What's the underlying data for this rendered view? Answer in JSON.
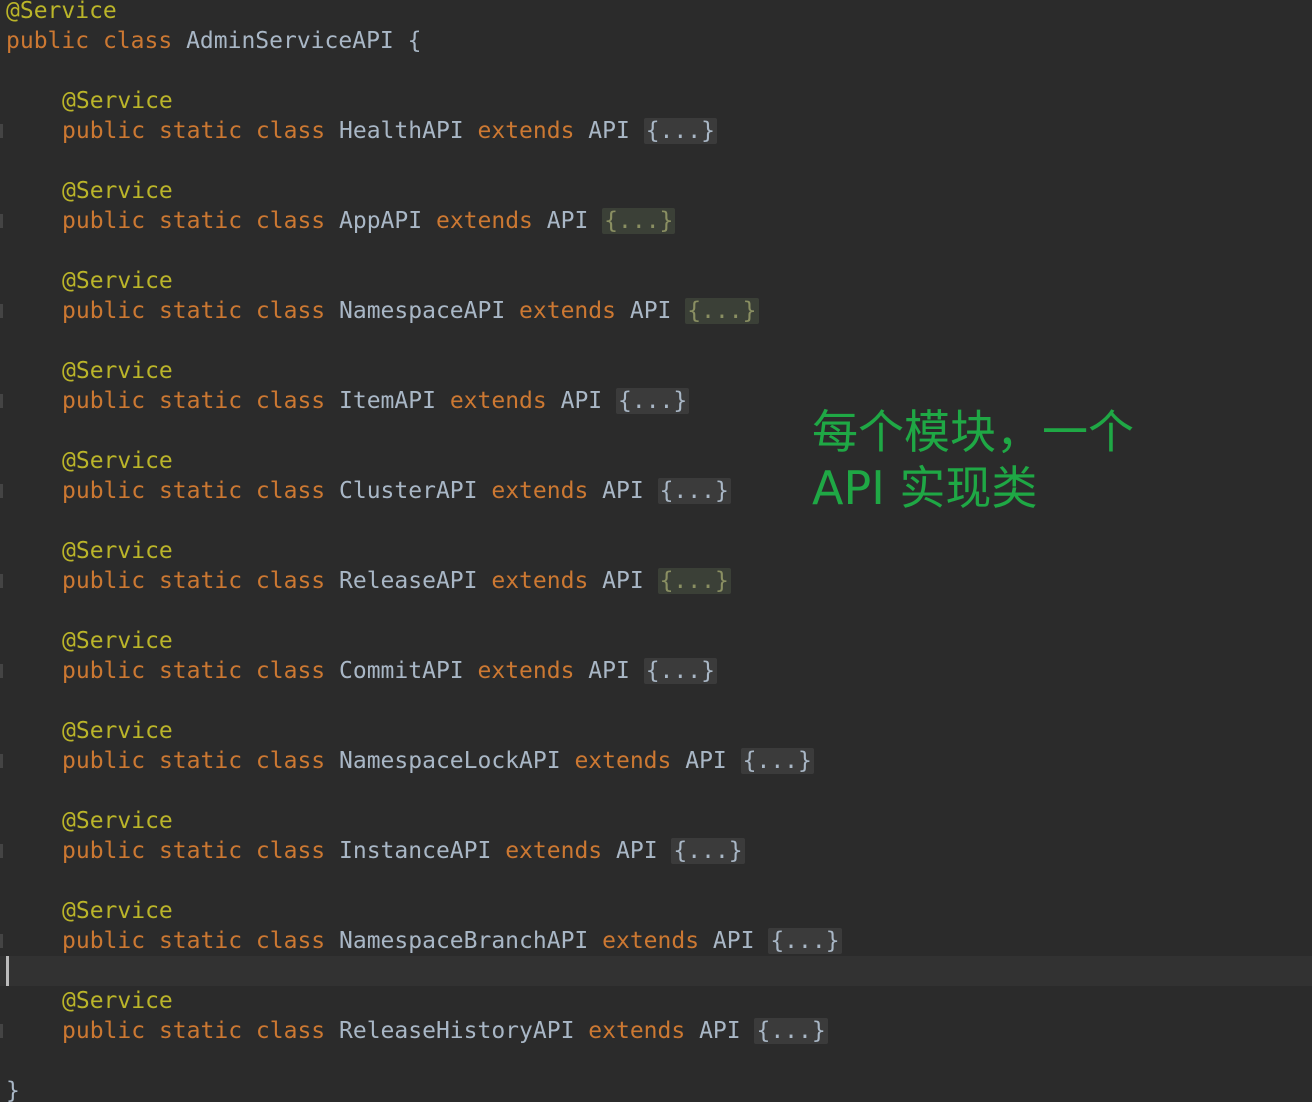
{
  "editor": {
    "annotation": "@Service",
    "outer_class": {
      "kw1": "public",
      "kw2": "class",
      "name": "AdminServiceAPI",
      "open_brace": "{",
      "close_brace": "}"
    },
    "inner_keywords": {
      "public": "public",
      "static": "static",
      "class": "class",
      "extends": "extends",
      "parent": "API",
      "folded": "{...}"
    },
    "inner_classes": [
      {
        "name": "HealthAPI",
        "fold_highlighted": false
      },
      {
        "name": "AppAPI",
        "fold_highlighted": true
      },
      {
        "name": "NamespaceAPI",
        "fold_highlighted": true
      },
      {
        "name": "ItemAPI",
        "fold_highlighted": false
      },
      {
        "name": "ClusterAPI",
        "fold_highlighted": false
      },
      {
        "name": "ReleaseAPI",
        "fold_highlighted": true
      },
      {
        "name": "CommitAPI",
        "fold_highlighted": false
      },
      {
        "name": "NamespaceLockAPI",
        "fold_highlighted": false
      },
      {
        "name": "InstanceAPI",
        "fold_highlighted": false
      },
      {
        "name": "NamespaceBranchAPI",
        "fold_highlighted": false
      },
      {
        "name": "ReleaseHistoryAPI",
        "fold_highlighted": false
      }
    ]
  },
  "overlay_note": {
    "line1": "每个模块，一个",
    "line2": "API 实现类"
  },
  "colors": {
    "background": "#2b2b2b",
    "annotation": "#bbb529",
    "keyword": "#cc7832",
    "identifier": "#a9b7c6",
    "note_text": "#1fa845"
  }
}
